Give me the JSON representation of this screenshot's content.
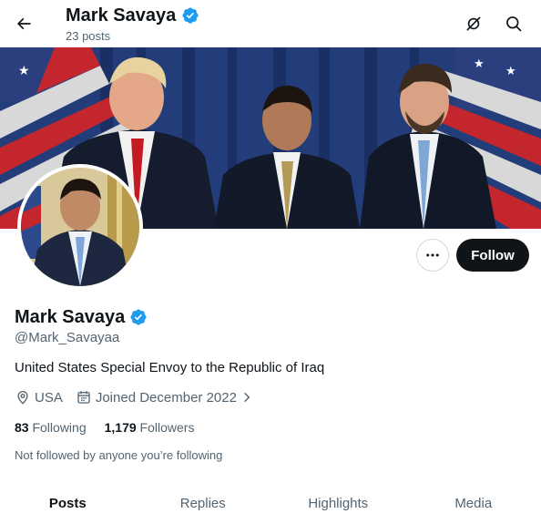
{
  "header": {
    "name": "Mark Savaya",
    "posts_count": "23 posts"
  },
  "profile": {
    "name": "Mark Savaya",
    "handle": "@Mark_Savayaa",
    "bio": "United States Special Envoy to the Republic of Iraq",
    "location": "USA",
    "joined": "Joined December 2022",
    "following_count": "83",
    "following_label": "Following",
    "followers_count": "1,179",
    "followers_label": "Followers",
    "not_followed_text": "Not followed by anyone you’re following",
    "verified_color": "#1d9bf0"
  },
  "actions": {
    "follow_label": "Follow",
    "more_icon": "more-horizontal-icon"
  },
  "tabs": [
    {
      "label": "Posts",
      "active": true
    },
    {
      "label": "Replies",
      "active": false
    },
    {
      "label": "Highlights",
      "active": false
    },
    {
      "label": "Media",
      "active": false
    }
  ]
}
